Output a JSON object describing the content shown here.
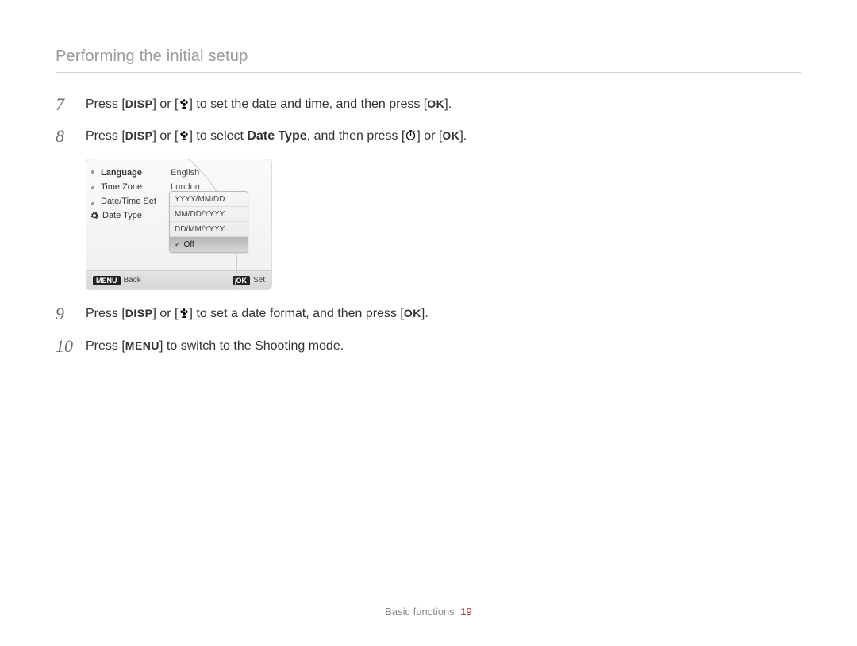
{
  "header": {
    "title": "Performing the initial setup"
  },
  "icons": {
    "disp": "DISP",
    "ok": "OK",
    "menu": "MENU",
    "macro": "macro-flower-icon",
    "timer": "self-timer-icon"
  },
  "steps": {
    "s7": {
      "num": "7",
      "t1": "Press [",
      "t2": "] or [",
      "t3": "] to set the date and time, and then press [",
      "t4": "]."
    },
    "s8": {
      "num": "8",
      "t1": "Press [",
      "t2": "] or [",
      "t3": "] to select ",
      "bold": "Date Type",
      "t4": ", and then press [",
      "t5": "] or [",
      "t6": "]."
    },
    "s9": {
      "num": "9",
      "t1": "Press [",
      "t2": "] or [",
      "t3": "] to set a date format, and then press [",
      "t4": "]."
    },
    "s10": {
      "num": "10",
      "t1": "Press [",
      "t2": "] to switch to the Shooting mode."
    }
  },
  "lcd": {
    "menu": {
      "language": {
        "label": "Language",
        "value": ": English"
      },
      "timezone": {
        "label": "Time Zone",
        "value": ": London"
      },
      "datetime": {
        "label": "Date/Time Set"
      },
      "datetype": {
        "label": "Date Type"
      }
    },
    "options": [
      "YYYY/MM/DD",
      "MM/DD/YYYY",
      "DD/MM/YYYY",
      "Off"
    ],
    "footer": {
      "backBtn": "MENU",
      "back": "Back",
      "setBtn": "OK",
      "set": "Set"
    }
  },
  "footer": {
    "section": "Basic functions",
    "page": "19"
  }
}
